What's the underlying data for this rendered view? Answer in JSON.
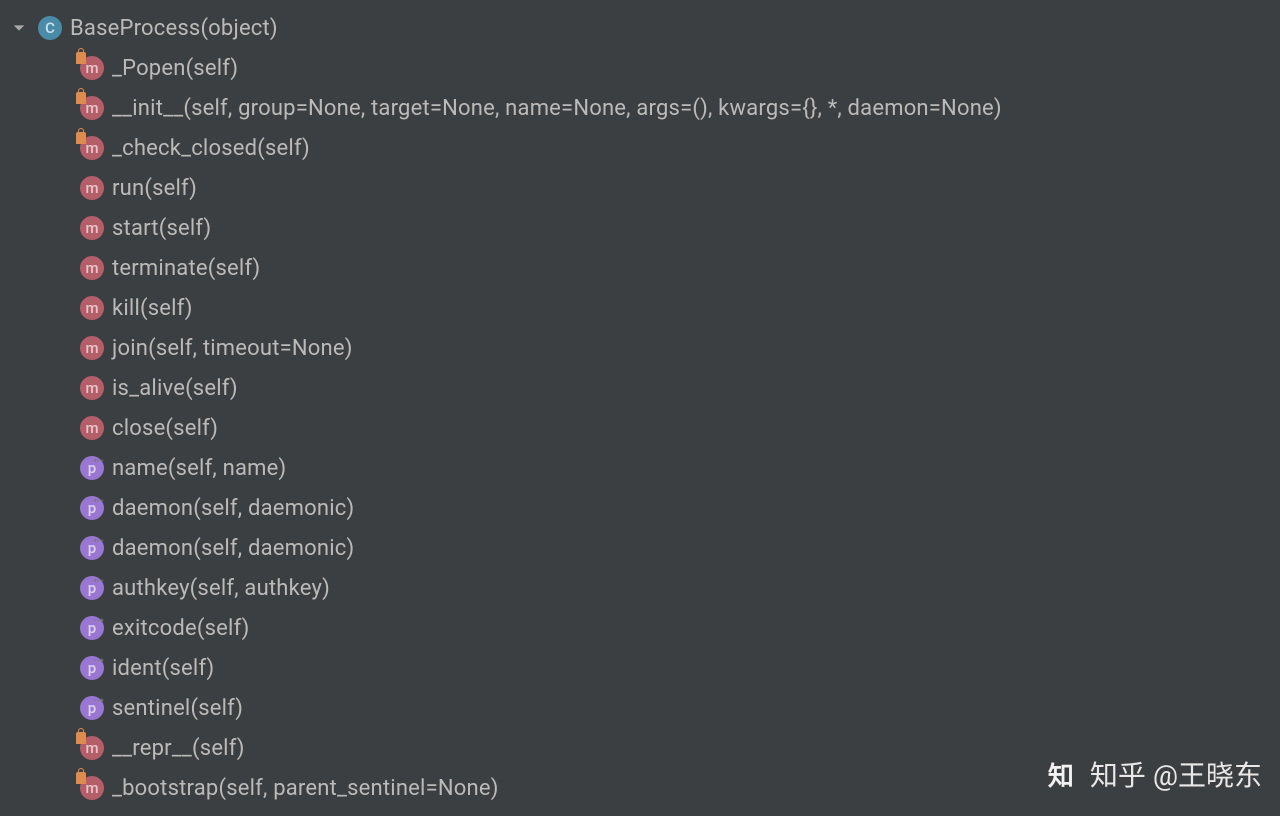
{
  "class_item": {
    "icon_letter": "C",
    "label": "BaseProcess(object)"
  },
  "members": [
    {
      "type": "method",
      "locked": true,
      "arrow": null,
      "label": "_Popen(self)"
    },
    {
      "type": "method",
      "locked": true,
      "arrow": null,
      "label": "__init__(self, group=None, target=None, name=None, args=(), kwargs={}, *, daemon=None)"
    },
    {
      "type": "method",
      "locked": true,
      "arrow": null,
      "label": "_check_closed(self)"
    },
    {
      "type": "method",
      "locked": false,
      "arrow": null,
      "label": "run(self)"
    },
    {
      "type": "method",
      "locked": false,
      "arrow": null,
      "label": "start(self)"
    },
    {
      "type": "method",
      "locked": false,
      "arrow": null,
      "label": "terminate(self)"
    },
    {
      "type": "method",
      "locked": false,
      "arrow": null,
      "label": "kill(self)"
    },
    {
      "type": "method",
      "locked": false,
      "arrow": null,
      "label": "join(self, timeout=None)"
    },
    {
      "type": "method",
      "locked": false,
      "arrow": null,
      "label": "is_alive(self)"
    },
    {
      "type": "method",
      "locked": false,
      "arrow": null,
      "label": "close(self)"
    },
    {
      "type": "property",
      "locked": false,
      "arrow": "left",
      "label": "name(self, name)"
    },
    {
      "type": "property",
      "locked": false,
      "arrow": "left",
      "label": "daemon(self, daemonic)"
    },
    {
      "type": "property",
      "locked": false,
      "arrow": "left",
      "label": "daemon(self, daemonic)"
    },
    {
      "type": "property",
      "locked": false,
      "arrow": "left",
      "label": "authkey(self, authkey)"
    },
    {
      "type": "property",
      "locked": false,
      "arrow": "right",
      "label": "exitcode(self)"
    },
    {
      "type": "property",
      "locked": false,
      "arrow": "right",
      "label": "ident(self)"
    },
    {
      "type": "property",
      "locked": false,
      "arrow": "right",
      "label": "sentinel(self)"
    },
    {
      "type": "method",
      "locked": true,
      "arrow": null,
      "label": "__repr__(self)"
    },
    {
      "type": "method",
      "locked": true,
      "arrow": null,
      "label": "_bootstrap(self, parent_sentinel=None)"
    }
  ],
  "icon_letters": {
    "method": "m",
    "property": "p"
  },
  "watermark": {
    "logo": "知",
    "text": "知乎 @王晓东"
  }
}
